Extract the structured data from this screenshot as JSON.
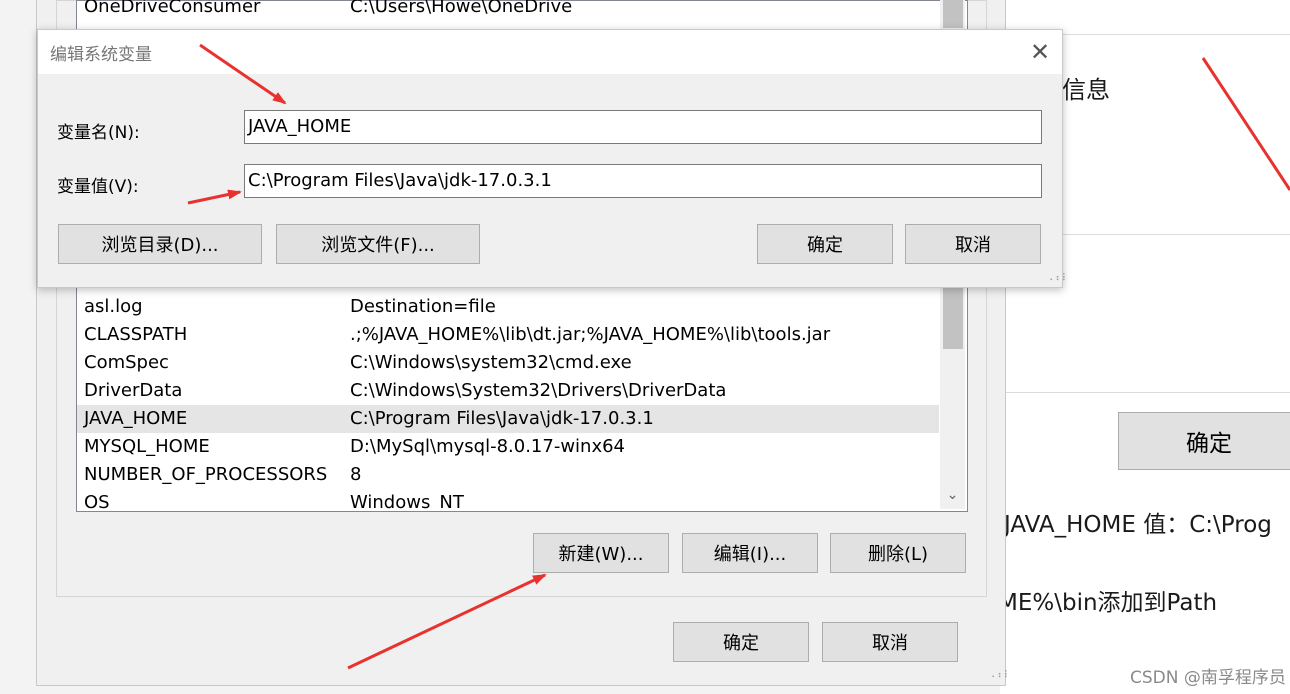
{
  "background": {
    "heading_fragment": "试信息",
    "ok_button": "确定",
    "text_line1": "JAVA_HOME  值：C:\\Prog",
    "text_line2": "ME%\\bin添加到Path",
    "watermark": "CSDN @南孚程序员"
  },
  "env_window": {
    "top_rows": [
      {
        "name": "OneDriveConsumer",
        "value": "C:\\Users\\Howe\\OneDrive"
      }
    ],
    "rows": [
      {
        "name": "asl.log",
        "value": "Destination=file"
      },
      {
        "name": "CLASSPATH",
        "value": ".;%JAVA_HOME%\\lib\\dt.jar;%JAVA_HOME%\\lib\\tools.jar"
      },
      {
        "name": "ComSpec",
        "value": "C:\\Windows\\system32\\cmd.exe"
      },
      {
        "name": "DriverData",
        "value": "C:\\Windows\\System32\\Drivers\\DriverData"
      },
      {
        "name": "JAVA_HOME",
        "value": "C:\\Program Files\\Java\\jdk-17.0.3.1"
      },
      {
        "name": "MYSQL_HOME",
        "value": "D:\\MySql\\mysql-8.0.17-winx64"
      },
      {
        "name": "NUMBER_OF_PROCESSORS",
        "value": "8"
      },
      {
        "name": "OS",
        "value": "Windows_NT"
      }
    ],
    "selected_row": "JAVA_HOME",
    "buttons": {
      "new": "新建(W)...",
      "edit": "编辑(I)...",
      "delete": "删除(L)",
      "ok": "确定",
      "cancel": "取消"
    }
  },
  "edit_dialog": {
    "title": "编辑系统变量",
    "close": "✕",
    "name_label": "变量名(N):",
    "name_value": "JAVA_HOME",
    "value_label": "变量值(V):",
    "value_value": "C:\\Program Files\\Java\\jdk-17.0.3.1",
    "buttons": {
      "browse_dir": "浏览目录(D)...",
      "browse_file": "浏览文件(F)...",
      "ok": "确定",
      "cancel": "取消"
    }
  },
  "colors": {
    "annotation_arrow": "#e8322f",
    "selected_row": "#e5e5e5",
    "button_face": "#e1e1e1"
  }
}
